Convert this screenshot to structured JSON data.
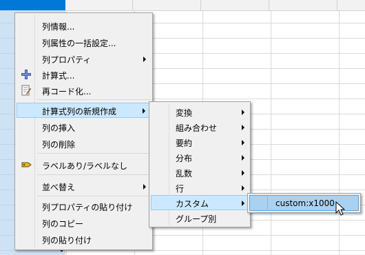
{
  "context_menu": {
    "items": [
      {
        "label": "列情報..."
      },
      {
        "label": "列属性の一括設定..."
      },
      {
        "label": "列プロパティ"
      },
      {
        "label": "計算式...",
        "icon": "plus-icon"
      },
      {
        "label": "再コード化...",
        "icon": "recode-icon"
      },
      {
        "label": "計算式列の新規作成"
      },
      {
        "label": "列の挿入"
      },
      {
        "label": "列の削除"
      },
      {
        "label": "ラベルあり/ラベルなし",
        "icon": "label-tag-icon"
      },
      {
        "label": "並べ替え"
      },
      {
        "label": "列プロパティの貼り付け"
      },
      {
        "label": "列のコピー"
      },
      {
        "label": "列の貼り付け"
      }
    ]
  },
  "submenu": {
    "items": [
      {
        "label": "変換"
      },
      {
        "label": "組み合わせ"
      },
      {
        "label": "要約"
      },
      {
        "label": "分布"
      },
      {
        "label": "乱数"
      },
      {
        "label": "行"
      },
      {
        "label": "カスタム"
      },
      {
        "label": "グループ別"
      }
    ]
  },
  "submenu2": {
    "items": [
      {
        "label": "custom:x1000"
      }
    ]
  },
  "colors": {
    "highlight": "#cce8ff",
    "selected_column": "#cfe2f3",
    "column_header_active": "#0078d7"
  }
}
